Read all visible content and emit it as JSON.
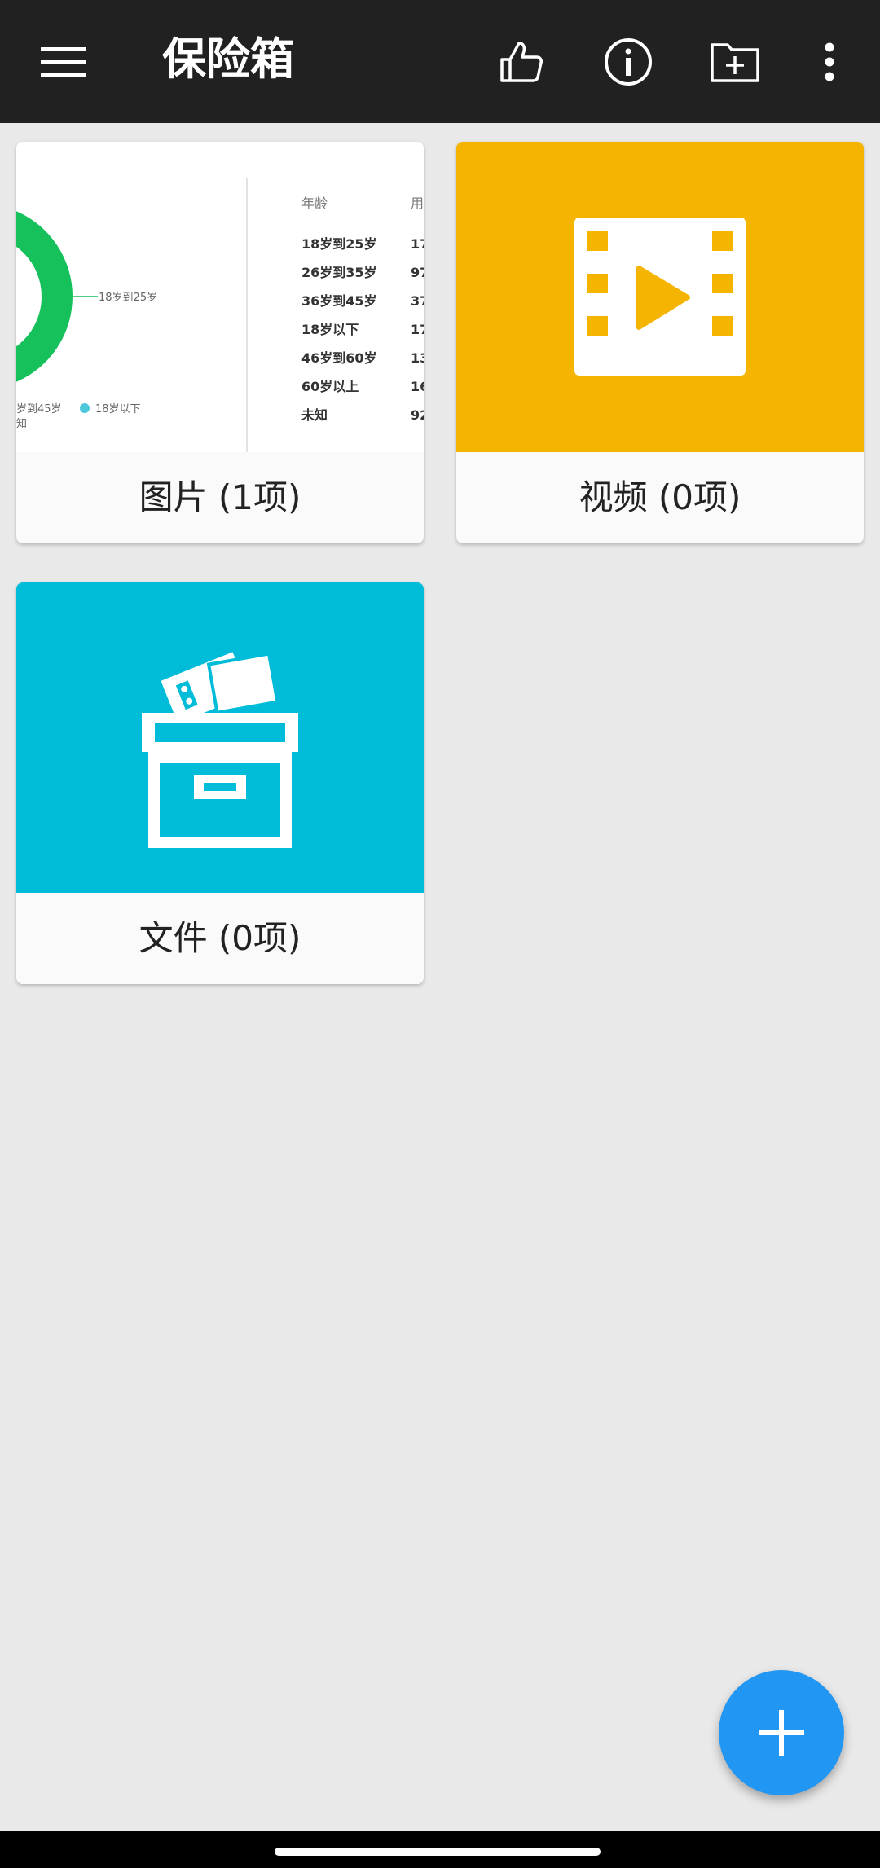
{
  "appbar": {
    "title": "保险箱",
    "icons": [
      "menu-icon",
      "thumbs-up-icon",
      "info-icon",
      "add-folder-icon",
      "more-vert-icon"
    ]
  },
  "folders": [
    {
      "label": "图片 (1项)",
      "color": "#ffffff"
    },
    {
      "label": "视频 (0项)",
      "color": "#f4b400"
    },
    {
      "label": "文件 (0项)",
      "color": "#00bcd9"
    }
  ],
  "photo_thumbnail": {
    "header": "年龄",
    "header2": "用",
    "rows": [
      {
        "age": "18岁到25岁",
        "val": "17"
      },
      {
        "age": "26岁到35岁",
        "val": "97"
      },
      {
        "age": "36岁到45岁",
        "val": "37"
      },
      {
        "age": "18岁以下",
        "val": "17"
      },
      {
        "age": "46岁到60岁",
        "val": "13"
      },
      {
        "age": "60岁以上",
        "val": "16"
      },
      {
        "age": "未知",
        "val": "92"
      }
    ],
    "donut_callout": "18岁到25岁",
    "legend_left": "岁到45岁",
    "legend_left2": "知",
    "legend_right": "18岁以下"
  },
  "fab": {
    "icon": "plus-icon"
  }
}
